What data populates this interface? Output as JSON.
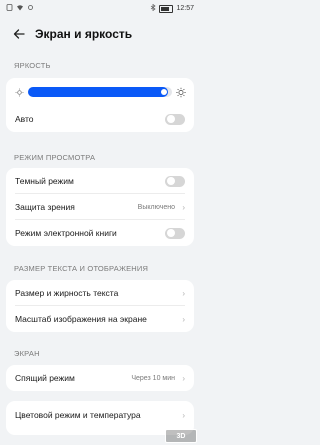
{
  "status_bar": {
    "left_icons": [
      "sim-icon",
      "wifi-icon",
      "network-icon"
    ],
    "time": "12:57"
  },
  "header": {
    "title": "Экран и яркость"
  },
  "brightness": {
    "section": "ЯРКОСТЬ",
    "level_fraction": 0.97,
    "auto_label": "Авто",
    "auto_on": false
  },
  "view_mode": {
    "section": "РЕЖИМ ПРОСМОТРА",
    "dark_mode_label": "Темный режим",
    "eye_comfort_label": "Защита зрения",
    "eye_comfort_value": "Выключено",
    "ebook_mode_label": "Режим электронной книги"
  },
  "text_display": {
    "section": "РАЗМЕР ТЕКСТА И ОТОБРАЖЕНИЯ",
    "text_size_label": "Размер и жирность текста",
    "display_scale_label": "Масштаб изображения на экране"
  },
  "screen": {
    "section": "ЭКРАН",
    "sleep_label": "Спящий режим",
    "sleep_value": "Через 10 мин",
    "color_label": "Цветовой режим и температура"
  },
  "watermark": "3D",
  "colors": {
    "accent": "#0a59f7",
    "background": "#f1f3f5",
    "card": "#ffffff"
  }
}
